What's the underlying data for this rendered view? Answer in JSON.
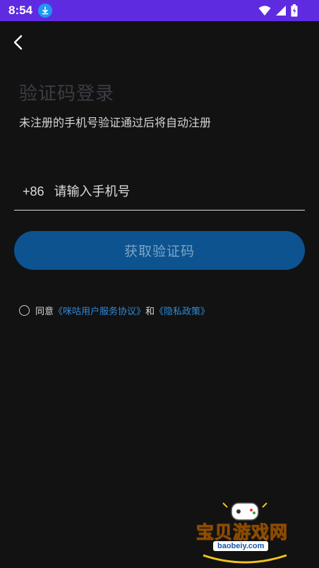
{
  "status_bar": {
    "time": "8:54",
    "icons": [
      "download-icon",
      "wifi-icon",
      "signal-icon",
      "battery-icon"
    ]
  },
  "header": {
    "back_icon": "chevron-left-icon"
  },
  "login": {
    "title": "验证码登录",
    "subtitle": "未注册的手机号验证通过后将自动注册",
    "country_code": "+86",
    "phone_placeholder": "请输入手机号",
    "get_code_label": "获取验证码"
  },
  "agreement": {
    "prefix": "同意",
    "service_link": "《咪咕用户服务协议》",
    "conjunction": "和",
    "privacy_link": "《隐私政策》"
  },
  "watermark": {
    "brand": "宝贝游戏网",
    "url": "baobeiy.com"
  },
  "colors": {
    "status_bar": "#5e2be0",
    "background": "#121212",
    "button": "#0c5390",
    "link": "#2d8ad8"
  }
}
